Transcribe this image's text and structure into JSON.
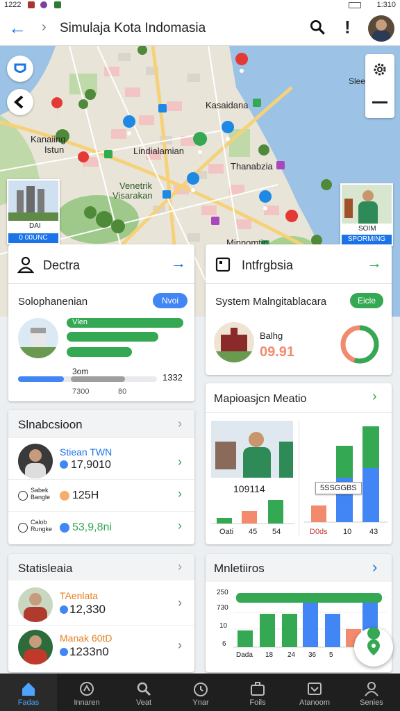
{
  "status": {
    "left": "1222",
    "right": "1:310"
  },
  "appbar": {
    "title": "Simulaja Kota Indomasia"
  },
  "map": {
    "labels": [
      "Kasaidana",
      "Kanaiing",
      "Istun",
      "Lindialamian",
      "Venetrik",
      "Visarakan",
      "Thanabzia",
      "Sleens",
      "Minnomtin"
    ],
    "left_photo": {
      "name": "DAI",
      "value": "0 00UNC"
    },
    "right_photo": {
      "name": "SOIM",
      "value": "SPORMING"
    }
  },
  "card_doctra": {
    "title": "Dectra",
    "subtitle": "Solophanenian",
    "badge": "Nvoi",
    "bar_label": "Vlen",
    "metric_label": "3om",
    "metric_value": "1332",
    "foot_left": "7300",
    "foot_right": "80",
    "bars": [
      0.86,
      0.7,
      0.5
    ]
  },
  "card_infra": {
    "title": "Intfrgbsia",
    "subtitle": "System Malngitablacara",
    "badge": "Eicle",
    "item_label": "Balhg",
    "item_value": "09.91",
    "ring_fraction": 0.55
  },
  "card_slnab": {
    "title": "Slnabcsioon",
    "rows": [
      {
        "name": "Stiean TWN",
        "value": "17,9010"
      },
      {
        "name": "Sabek Bangle",
        "value": "125H"
      },
      {
        "name": "Calob Rungke",
        "value": "53,9,8ni"
      }
    ]
  },
  "card_mapio": {
    "title": "Mapioasjcn Meatio",
    "photo_value": "109114",
    "x_labels": [
      "Oati",
      "45",
      "54"
    ],
    "tooltip": "5SSGGBS",
    "right_x_labels": [
      "D0ds",
      "10",
      "43"
    ]
  },
  "card_stats": {
    "title": "Statisleaia",
    "rows": [
      {
        "name": "TAenlata",
        "value": "12,330"
      },
      {
        "name": "Manak 60tD",
        "value": "1233n0"
      }
    ]
  },
  "card_mnlet": {
    "title": "Mnletiiros",
    "y_labels": [
      "250",
      "730",
      "10",
      "6"
    ],
    "x_labels": [
      "Dada",
      "18",
      "24",
      "36",
      "5"
    ]
  },
  "nav": [
    {
      "label": "Fadas",
      "icon": "home-icon"
    },
    {
      "label": "Innaren",
      "icon": "compass-icon"
    },
    {
      "label": "Veat",
      "icon": "search-icon"
    },
    {
      "label": "Ynar",
      "icon": "clock-icon"
    },
    {
      "label": "Foils",
      "icon": "briefcase-icon"
    },
    {
      "label": "Atanoom",
      "icon": "inbox-icon"
    },
    {
      "label": "Senies",
      "icon": "person-icon"
    }
  ],
  "colors": {
    "accent": "#1a73e8",
    "green": "#34a853",
    "blue": "#4285f4",
    "orange": "#f28b6d"
  }
}
